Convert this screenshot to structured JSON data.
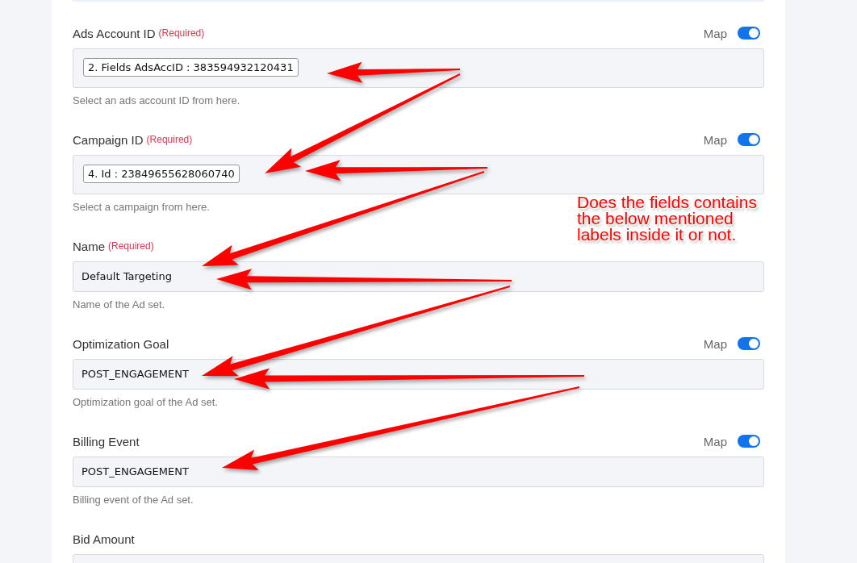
{
  "fields": [
    {
      "label": "Ads Account ID",
      "required": "(Required)",
      "map": {
        "label": "Map",
        "on": true
      },
      "kind": "token",
      "value": "2. Fields AdsAccID : 383594932120431",
      "help": "Select an ads account ID from here."
    },
    {
      "label": "Campaign ID",
      "required": "(Required)",
      "map": {
        "label": "Map",
        "on": true
      },
      "kind": "token",
      "value": "4. Id : 23849655628060740",
      "help": "Select a campaign from here."
    },
    {
      "label": "Name",
      "required": "(Required)",
      "kind": "text",
      "value": "Default Targeting",
      "help": "Name of the Ad set."
    },
    {
      "label": "Optimization Goal",
      "map": {
        "label": "Map",
        "on": true
      },
      "kind": "text",
      "value": "POST_ENGAGEMENT",
      "help": "Optimization goal of the Ad set."
    },
    {
      "label": "Billing Event",
      "map": {
        "label": "Map",
        "on": true
      },
      "kind": "text",
      "value": "POST_ENGAGEMENT",
      "help": "Billing event of the Ad set."
    },
    {
      "label": "Bid Amount",
      "kind": "text"
    }
  ],
  "annotation": {
    "note": "Does the fields contains the below mentioned labels inside it or not."
  }
}
